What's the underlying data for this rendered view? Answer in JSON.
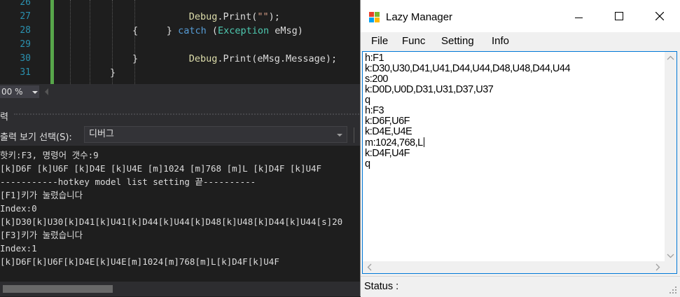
{
  "editor": {
    "line_numbers": [
      "26",
      "27",
      "28",
      "29",
      "30",
      "31"
    ],
    "code_lines": {
      "l26": {
        "fn": "Debug",
        "rest": ".Print(\"\");",
        "rest_prefix": "",
        "str": "\"\""
      },
      "l27_brace": "}",
      "l27_kw": "catch",
      "l27_open": "(",
      "l27_type": "Exception",
      "l27_var": "eMsg)",
      "l28": "{",
      "l29_fn": "Debug",
      "l29_rest": ".Print(eMsg.Message);",
      "l30": "}",
      "l31": "}"
    },
    "zoom": "00 %"
  },
  "output": {
    "title": "력",
    "source_label": "출력 보기 선택(S):",
    "source_value": "디버그",
    "lines": [
      "핫키:F3, 명령어 갯수:9",
      "[k]D6F [k]U6F [k]D4E [k]U4E [m]1024 [m]768 [m]L [k]D4F [k]U4F",
      "-----------hotkey model list setting 끝----------",
      "[F1]키가 눌렸습니다",
      "Index:0",
      "[k]D30[k]U30[k]D41[k]U41[k]D44[k]U44[k]D48[k]U48[k]D44[k]U44[s]20",
      "[F3]키가 눌렸습니다",
      "Index:1",
      "[k]D6F[k]U6F[k]D4E[k]U4E[m]1024[m]768[m]L[k]D4F[k]U4F"
    ]
  },
  "window": {
    "title": "Lazy Manager",
    "menu": [
      "File",
      "Func",
      "Setting",
      "Info"
    ],
    "text_lines": [
      "h:F1",
      "k:D30,U30,D41,U41,D44,U44,D48,U48,D44,U44",
      "s:200",
      "k:D0D,U0D,D31,U31,D37,U37",
      "q",
      "h:F3",
      "k:D6F,U6F",
      "k:D4E,U4E",
      "m:1024,768,L",
      "k:D4F,U4F",
      "q"
    ],
    "status_label": "Status :",
    "icons": [
      "app-icon",
      "minimize-icon",
      "maximize-icon",
      "close-icon",
      "scroll-up-icon",
      "scroll-down-icon",
      "scroll-left-icon",
      "scroll-right-icon",
      "size-grip-icon"
    ]
  }
}
